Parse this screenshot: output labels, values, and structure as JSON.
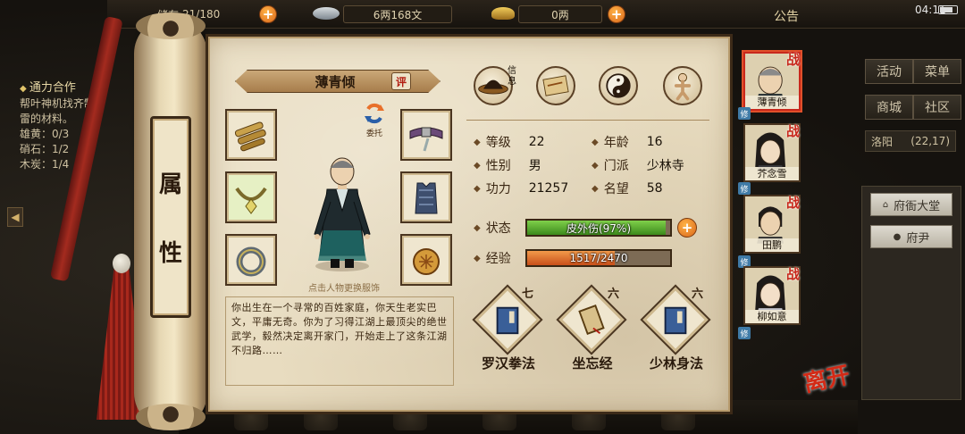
{
  "topbar": {
    "capacity_label": "储存",
    "capacity": "21/180",
    "silver": "6两168文",
    "gold": "0两",
    "announcement": "公告"
  },
  "statusbar": {
    "time": "04:11"
  },
  "quest": {
    "title": "通力合作",
    "lines": [
      "帮叶神机找齐制",
      "雷的材料。",
      "雄黄：0/3",
      "硝石：1/2",
      "木炭：1/4"
    ]
  },
  "scroll": {
    "char1": "属",
    "char2": "性"
  },
  "character": {
    "name": "薄青倾",
    "eval_label": "评",
    "entrust_label": "委托",
    "portrait_hint": "点击人物更换服饰",
    "bio": "你出生在一个寻常的百姓家庭，你天生老实巴文，平庸无奇。你为了习得江湖上最顶尖的绝世武学，毅然决定离开家门，开始走上了这条江湖不归路……"
  },
  "top_icons": [
    {
      "name": "info-hat-icon",
      "tag": "信息"
    },
    {
      "name": "map-icon"
    },
    {
      "name": "bagua-icon"
    },
    {
      "name": "meridian-icon"
    }
  ],
  "stats": {
    "level_label": "等级",
    "level": "22",
    "age_label": "年龄",
    "age": "16",
    "gender_label": "性别",
    "gender": "男",
    "sect_label": "门派",
    "sect": "少林寺",
    "power_label": "功力",
    "power": "21257",
    "fame_label": "名望",
    "fame": "58",
    "status_label": "状态",
    "status_text": "皮外伤(97%)",
    "status_fraction": 0.97,
    "exp_label": "经验",
    "exp_text": "1517/2470",
    "exp_fraction": 0.614
  },
  "skills": [
    {
      "rank": "七",
      "name": "罗汉拳法",
      "icon": "manual-book-icon"
    },
    {
      "rank": "六",
      "name": "坐忘经",
      "icon": "scroll-icon"
    },
    {
      "rank": "六",
      "name": "少林身法",
      "icon": "manual-book-icon"
    }
  ],
  "party": [
    {
      "name": "薄青倾",
      "mark": "战",
      "xiu": "修",
      "selected": true
    },
    {
      "name": "芥念雪",
      "mark": "战",
      "xiu": "修"
    },
    {
      "name": "田鹏",
      "mark": "战",
      "xiu": "修"
    },
    {
      "name": "柳如意",
      "mark": "战",
      "xiu": "修"
    }
  ],
  "right_menu": {
    "activity": "活动",
    "menu": "菜单",
    "shop": "商城",
    "community": "社区",
    "location": "洛阳",
    "coords": "(22,17)",
    "building1": "府衙大堂",
    "building2": "府尹"
  },
  "leave_label": "离开",
  "colors": {
    "parchment": "#e8dcc0",
    "hp_bar": "#4fa82a",
    "exp_bar": "#e46a1a",
    "battle_red": "#c8281c"
  }
}
